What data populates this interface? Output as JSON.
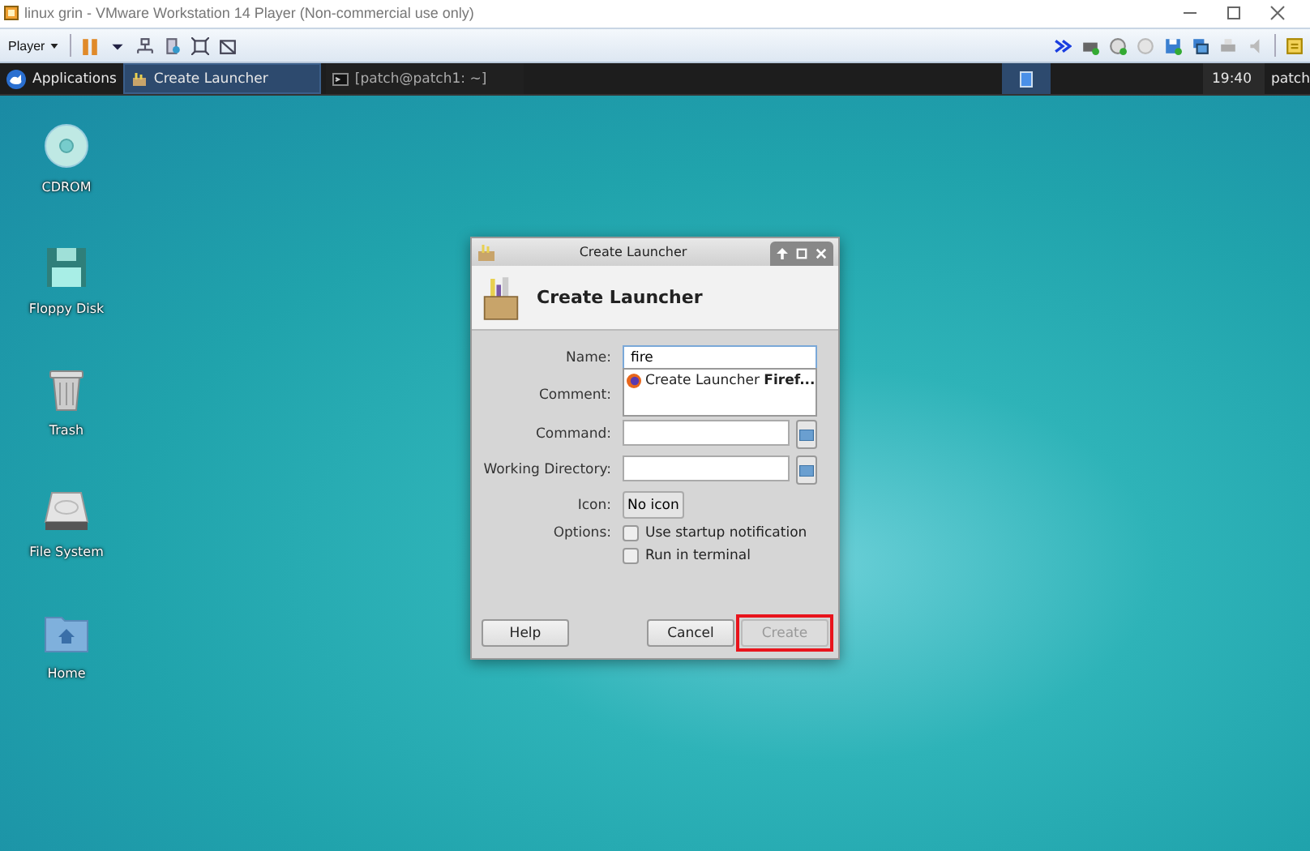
{
  "host_window": {
    "title": "linux grin - VMware Workstation 14 Player (Non-commercial use only)"
  },
  "vm_toolbar": {
    "player_menu": "Player"
  },
  "panel": {
    "applications": "Applications",
    "tasks": [
      {
        "label": "Create Launcher",
        "selected": true,
        "kind": "launcher"
      },
      {
        "label": "[patch@patch1: ~]",
        "selected": false,
        "kind": "terminal"
      }
    ],
    "clock": "19:40",
    "user": "patch"
  },
  "desktop_icons": [
    {
      "label": "CDROM",
      "kind": "disc"
    },
    {
      "label": "Floppy Disk",
      "kind": "floppy"
    },
    {
      "label": "Trash",
      "kind": "trash"
    },
    {
      "label": "File System",
      "kind": "drive"
    },
    {
      "label": "Home",
      "kind": "folder"
    }
  ],
  "dialog": {
    "title": "Create Launcher",
    "heading": "Create Launcher",
    "fields": [
      {
        "label": "Name:",
        "kind": "text",
        "value": "fire"
      },
      {
        "label": "Comment:",
        "kind": "suggest",
        "suggestion": "Create Launcher **Firef...**"
      },
      {
        "label": "Command:",
        "kind": "browse"
      },
      {
        "label": "Working Directory:",
        "kind": "browse"
      },
      {
        "label": "Icon:",
        "kind": "icon",
        "value": "No icon"
      }
    ],
    "options_label": "Options:",
    "options": [
      {
        "label": "Use startup notification",
        "checked": false
      },
      {
        "label": "Run in terminal",
        "checked": false
      }
    ],
    "buttons": [
      {
        "label": "Help",
        "kind": "left",
        "disabled": false,
        "highlighted": false
      },
      {
        "label": "Cancel",
        "kind": "right",
        "disabled": false,
        "highlighted": false
      },
      {
        "label": "Create",
        "kind": "right",
        "disabled": true,
        "highlighted": true
      }
    ]
  }
}
